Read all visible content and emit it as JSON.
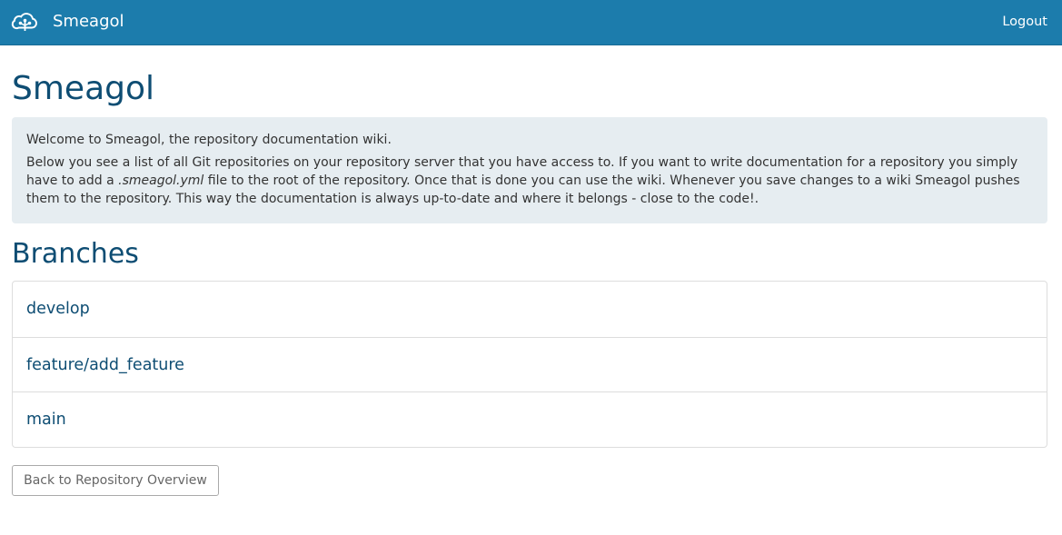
{
  "navbar": {
    "brand_name": "Smeagol",
    "brand_icon": "cloud-icon",
    "logout_label": "Logout",
    "background_color": "#1c7cac"
  },
  "page": {
    "title": "Smeagol"
  },
  "info": {
    "line1": "Welcome to Smeagol, the repository documentation wiki.",
    "line2_before": "Below you see a list of all Git repositories on your repository server that you have access to. If you want to write documentation for a repository you simply have to add a ",
    "line2_file": ".smeagol.yml",
    "line2_after": " file to the root of the repository. Once that is done you can use the wiki. Whenever you save changes to a wiki Smeagol pushes them to the repository. This way the documentation is always up-to-date and where it belongs - close to the code!."
  },
  "branches": {
    "title": "Branches",
    "items": [
      {
        "name": "develop"
      },
      {
        "name": "feature/add_feature"
      },
      {
        "name": "main"
      }
    ]
  },
  "back_button": {
    "label": "Back to Repository Overview"
  }
}
